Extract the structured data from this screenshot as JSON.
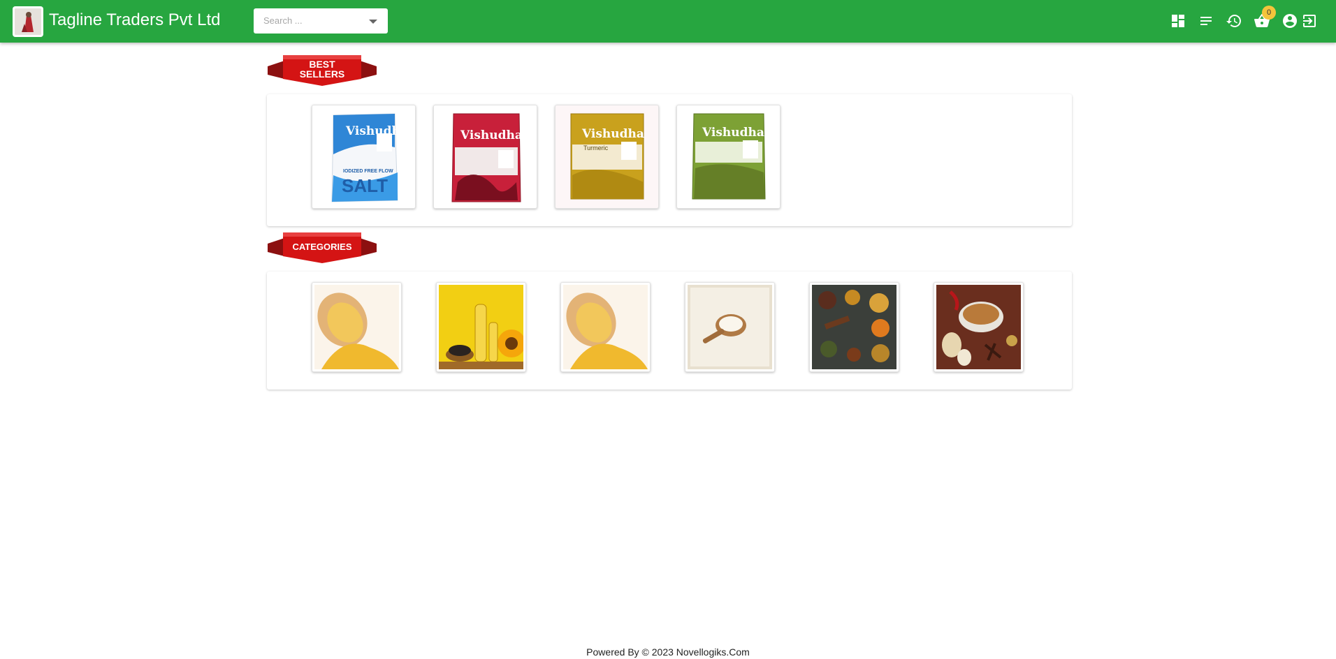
{
  "header": {
    "title": "Tagline Traders Pvt Ltd",
    "search_placeholder": "Search ...",
    "cart_count": "0",
    "colors": {
      "bar": "#27a640",
      "badge": "#f4c43b"
    },
    "icons": [
      "dashboard-icon",
      "menu-list-icon",
      "history-icon",
      "cart-icon",
      "account-icon",
      "logout-icon"
    ]
  },
  "best_sellers": {
    "label_line1": "BEST",
    "label_line2": "SELLERS",
    "products": [
      {
        "brand": "Vishudha",
        "text": "SALT",
        "sub": "IODIZED FREE FLOW",
        "color": "#2f86d6"
      },
      {
        "brand": "Vishudha",
        "text": "",
        "sub": "",
        "color": "#c8203a"
      },
      {
        "brand": "Vishudha",
        "text": "",
        "sub": "Turmeric",
        "color": "#c9a11d"
      },
      {
        "brand": "Vishudha",
        "text": "",
        "sub": "",
        "color": "#7da135"
      }
    ]
  },
  "categories": {
    "label": "CATEGORIES",
    "items": [
      {
        "icon": "lentils-image"
      },
      {
        "icon": "sunflower-oil-image"
      },
      {
        "icon": "lentils-image"
      },
      {
        "icon": "rice-image"
      },
      {
        "icon": "spices-image"
      },
      {
        "icon": "masala-powder-image"
      }
    ]
  },
  "footer": {
    "text": "Powered By © 2023 Novellogiks.Com"
  }
}
